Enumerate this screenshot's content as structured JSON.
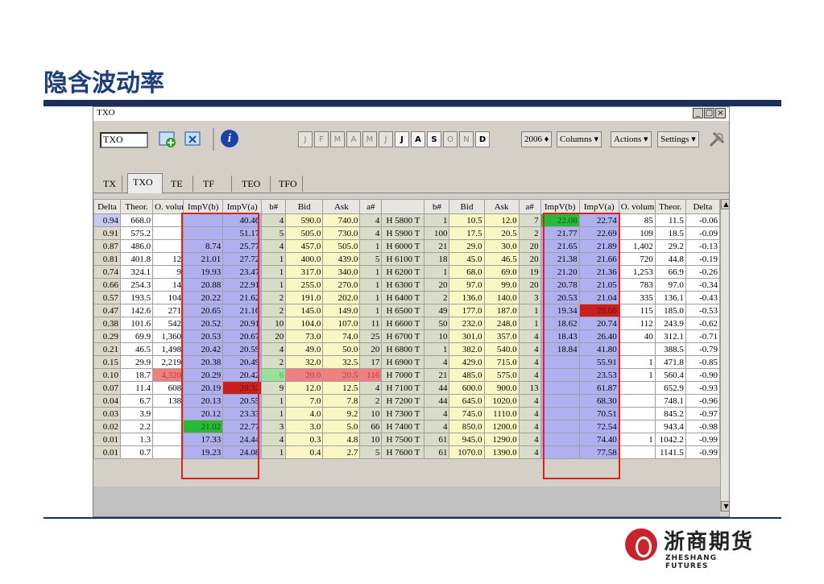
{
  "slide": {
    "title": "隐含波动率",
    "logo_cn": "浙商期货",
    "logo_en": "ZHESHANG FUTURES"
  },
  "window": {
    "title": "TXO",
    "symbol_value": "TXO",
    "window_buttons": [
      "_",
      "□",
      "×"
    ],
    "months": [
      "J",
      "F",
      "M",
      "A",
      "M",
      "J",
      "J",
      "A",
      "S",
      "O",
      "N",
      "D"
    ],
    "active_months": [
      6,
      7,
      8,
      11
    ],
    "year": "2006",
    "columns_label": "Columns",
    "actions_label": "Actions",
    "settings_label": "Settings",
    "tabs": [
      "TX",
      "TXO",
      "TE",
      "TF",
      "TEO",
      "TFO"
    ],
    "active_tab": "TXO"
  },
  "table": {
    "headers": [
      "Delta",
      "Theor.",
      "O. volum",
      "ImpV(b)",
      "ImpV(a)",
      "b#",
      "Bid",
      "Ask",
      "a#",
      "",
      "b#",
      "Bid",
      "Ask",
      "a#",
      "ImpV(b)",
      "ImpV(a)",
      "O. volum",
      "Theor.",
      "Delta"
    ],
    "rows": [
      [
        "0.94",
        "668.0",
        "",
        "",
        "40.46",
        "4",
        "590.0",
        "740.0",
        "4",
        "H 5800 T",
        "1",
        "10.5",
        "12.0",
        "7",
        "22.08",
        "22.74",
        "85",
        "11.5",
        "-0.06"
      ],
      [
        "0.91",
        "575.2",
        "",
        "",
        "51.17",
        "5",
        "505.0",
        "730.0",
        "4",
        "H 5900 T",
        "100",
        "17.5",
        "20.5",
        "2",
        "21.77",
        "22.69",
        "109",
        "18.5",
        "-0.09"
      ],
      [
        "0.87",
        "486.0",
        "",
        "8.74",
        "25.77",
        "4",
        "457.0",
        "505.0",
        "1",
        "H 6000 T",
        "21",
        "29.0",
        "30.0",
        "20",
        "21.65",
        "21.89",
        "1,402",
        "29.2",
        "-0.13"
      ],
      [
        "0.81",
        "401.8",
        "12",
        "21.01",
        "27.72",
        "1",
        "400.0",
        "439.0",
        "5",
        "H 6100 T",
        "18",
        "45.0",
        "46.5",
        "20",
        "21.38",
        "21.66",
        "720",
        "44.8",
        "-0.19"
      ],
      [
        "0.74",
        "324.1",
        "9",
        "19.93",
        "23.47",
        "1",
        "317.0",
        "340.0",
        "1",
        "H 6200 T",
        "1",
        "68.0",
        "69.0",
        "19",
        "21.20",
        "21.36",
        "1,253",
        "66.9",
        "-0.26"
      ],
      [
        "0.66",
        "254.3",
        "14",
        "20.88",
        "22.91",
        "1",
        "255.0",
        "270.0",
        "1",
        "H 6300 T",
        "20",
        "97.0",
        "99.0",
        "20",
        "20.78",
        "21.05",
        "783",
        "97.0",
        "-0.34"
      ],
      [
        "0.57",
        "193.5",
        "104",
        "20.22",
        "21.62",
        "2",
        "191.0",
        "202.0",
        "1",
        "H 6400 T",
        "2",
        "136.0",
        "140.0",
        "3",
        "20.53",
        "21.04",
        "335",
        "136.1",
        "-0.43"
      ],
      [
        "0.47",
        "142.6",
        "271",
        "20.65",
        "21.16",
        "2",
        "145.0",
        "149.0",
        "1",
        "H 6500 T",
        "49",
        "177.0",
        "187.0",
        "1",
        "19.34",
        "20.66",
        "115",
        "185.0",
        "-0.53"
      ],
      [
        "0.38",
        "101.6",
        "542",
        "20.52",
        "20.91",
        "10",
        "104.0",
        "107.0",
        "11",
        "H 6600 T",
        "50",
        "232.0",
        "248.0",
        "1",
        "18.62",
        "20.74",
        "112",
        "243.9",
        "-0.62"
      ],
      [
        "0.29",
        "69.9",
        "1,360",
        "20.53",
        "20.67",
        "20",
        "73.0",
        "74.0",
        "25",
        "H 6700 T",
        "10",
        "301.0",
        "357.0",
        "4",
        "18.43",
        "26.40",
        "40",
        "312.1",
        "-0.71"
      ],
      [
        "0.21",
        "46.5",
        "1,498",
        "20.42",
        "20.59",
        "4",
        "49.0",
        "50.0",
        "20",
        "H 6800 T",
        "1",
        "382.0",
        "540.0",
        "4",
        "18.84",
        "41.80",
        "",
        "388.5",
        "-0.79"
      ],
      [
        "0.15",
        "29.9",
        "2,219",
        "20.38",
        "20.49",
        "2",
        "32.0",
        "32.5",
        "17",
        "H 6900 T",
        "4",
        "429.0",
        "715.0",
        "4",
        "",
        "55.91",
        "1",
        "471.8",
        "-0.85"
      ],
      [
        "0.10",
        "18.7",
        "4,320",
        "20.29",
        "20.42",
        "6",
        "20.0",
        "20.5",
        "116",
        "H 7000 T",
        "21",
        "485.0",
        "575.0",
        "4",
        "",
        "23.53",
        "1",
        "560.4",
        "-0.90"
      ],
      [
        "0.07",
        "11.4",
        "608",
        "20.19",
        "20.32",
        "9",
        "12.0",
        "12.5",
        "4",
        "H 7100 T",
        "44",
        "600.0",
        "900.0",
        "13",
        "",
        "61.87",
        "",
        "652.9",
        "-0.93"
      ],
      [
        "0.04",
        "6.7",
        "138",
        "20.13",
        "20.55",
        "1",
        "7.0",
        "7.8",
        "2",
        "H 7200 T",
        "44",
        "645.0",
        "1020.0",
        "4",
        "",
        "68.30",
        "",
        "748.1",
        "-0.96"
      ],
      [
        "0.03",
        "3.9",
        "",
        "20.12",
        "23.33",
        "1",
        "4.0",
        "9.2",
        "10",
        "H 7300 T",
        "4",
        "745.0",
        "1110.0",
        "4",
        "",
        "70.51",
        "",
        "845.2",
        "-0.97"
      ],
      [
        "0.02",
        "2.2",
        "",
        "21.02",
        "22.77",
        "3",
        "3.0",
        "5.0",
        "66",
        "H 7400 T",
        "4",
        "850.0",
        "1200.0",
        "4",
        "",
        "72.54",
        "",
        "943.4",
        "-0.98"
      ],
      [
        "0.01",
        "1.3",
        "",
        "17.33",
        "24.44",
        "4",
        "0.3",
        "4.8",
        "10",
        "H 7500 T",
        "61",
        "945.0",
        "1290.0",
        "4",
        "",
        "74.40",
        "1",
        "1042.2",
        "-0.99"
      ],
      [
        "0.01",
        "0.7",
        "",
        "19.23",
        "24.08",
        "1",
        "0.4",
        "2.7",
        "5",
        "H 7600 T",
        "61",
        "1070.0",
        "1390.0",
        "4",
        "",
        "77.58",
        "",
        "1141.5",
        "-0.99"
      ]
    ],
    "highlights": [
      {
        "row": 0,
        "col": 14,
        "color": "green"
      },
      {
        "row": 7,
        "col": 15,
        "color": "red"
      },
      {
        "row": 12,
        "col": 2,
        "color": "pink"
      },
      {
        "row": 12,
        "col": 5,
        "color": "lgreen"
      },
      {
        "row": 12,
        "col": 6,
        "color": "pink"
      },
      {
        "row": 12,
        "col": 7,
        "color": "pink"
      },
      {
        "row": 12,
        "col": 8,
        "color": "pink"
      },
      {
        "row": 13,
        "col": 4,
        "color": "red"
      },
      {
        "row": 16,
        "col": 3,
        "color": "green"
      }
    ]
  },
  "colors": {
    "bid_ask": "#fbf7c4",
    "impv": "#b0b0f0",
    "title": "#1f3f7a",
    "band": "#1b2f5b",
    "box": "#e02020"
  }
}
